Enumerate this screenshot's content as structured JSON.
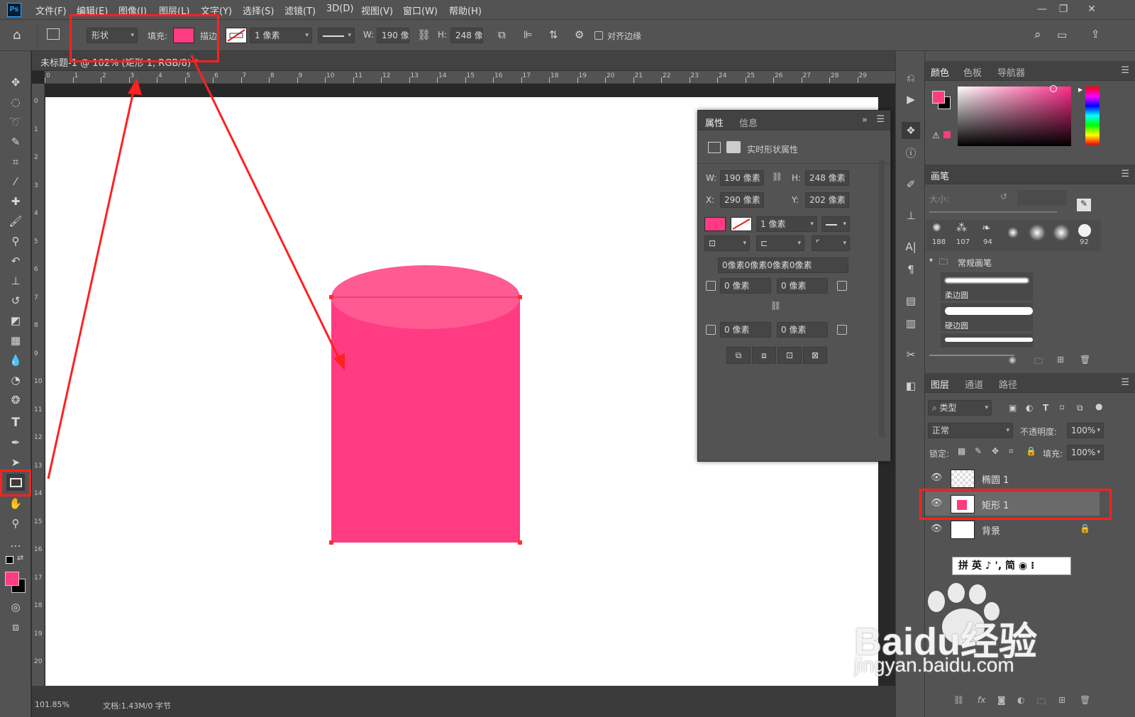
{
  "app": {
    "logo": "Ps"
  },
  "menu": [
    "文件(F)",
    "编辑(E)",
    "图像(I)",
    "图层(L)",
    "文字(Y)",
    "选择(S)",
    "滤镜(T)",
    "3D(D)",
    "视图(V)",
    "窗口(W)",
    "帮助(H)"
  ],
  "options_bar": {
    "mode": "形状",
    "fill_label": "填充:",
    "fill_color": "#ff3b82",
    "stroke_label": "描边:",
    "stroke_width": "1 像素",
    "w_label": "W:",
    "w_value": "190 像素",
    "h_label": "H:",
    "h_value": "248 像素",
    "align_edges": "对齐边缘"
  },
  "document": {
    "tab_title": "未标题-1 @ 102% (矩形 1, RGB/8) *",
    "zoom_status": "101.85%",
    "doc_status": "文档:1.43M/0 字节"
  },
  "ruler_h": [
    "0",
    "1",
    "2",
    "3",
    "4",
    "5",
    "6",
    "7",
    "8",
    "9",
    "10",
    "11",
    "12",
    "13",
    "14",
    "15",
    "16",
    "17",
    "18",
    "19",
    "20",
    "21",
    "22",
    "23",
    "24",
    "25",
    "26",
    "27",
    "28",
    "29"
  ],
  "ruler_v": [
    "0",
    "1",
    "2",
    "3",
    "4",
    "5",
    "6",
    "7",
    "8",
    "9",
    "10",
    "11",
    "12",
    "13",
    "14",
    "15",
    "16",
    "17",
    "18",
    "19",
    "20"
  ],
  "canvas_shapes": {
    "rect_color": "#ff3b82",
    "ellipse_color": "#ff5a92",
    "handle_color": "#ff3030"
  },
  "properties": {
    "tabs": [
      "属性",
      "信息"
    ],
    "title": "实时形状属性",
    "w_label": "W:",
    "w": "190 像素",
    "h_label": "H:",
    "h": "248 像素",
    "x_label": "X:",
    "x": "290 像素",
    "y_label": "Y:",
    "y": "202 像素",
    "stroke_width": "1 像素",
    "corners_summary": "0像素0像素0像素0像素",
    "corner_tl": "0 像素",
    "corner_tr": "0 像素",
    "corner_bl": "0 像素",
    "corner_br": "0 像素"
  },
  "color_panel": {
    "tabs": [
      "颜色",
      "色板",
      "导航器"
    ],
    "fg": "#ff3b82",
    "bg": "#000000"
  },
  "brush_panel": {
    "title": "画笔",
    "size_label": "大小:",
    "presets": [
      "188",
      "107",
      "94",
      "",
      "",
      "",
      "92"
    ],
    "group": "常规画笔",
    "items": [
      "柔边圆",
      "硬边圆"
    ]
  },
  "layers_panel": {
    "tabs": [
      "图层",
      "通道",
      "路径"
    ],
    "filter": "类型",
    "blend_mode": "正常",
    "opacity_label": "不透明度:",
    "opacity": "100%",
    "lock_label": "锁定:",
    "fill_label": "填充:",
    "fill": "100%",
    "layers": [
      {
        "name": "椭圆 1"
      },
      {
        "name": "矩形 1"
      },
      {
        "name": "背景"
      }
    ]
  },
  "ime_bar": "拼 英 ♪ ', 简 ◉ ⁝",
  "watermark": {
    "brand": "Baidu经验",
    "url": "jingyan.baidu.com"
  }
}
